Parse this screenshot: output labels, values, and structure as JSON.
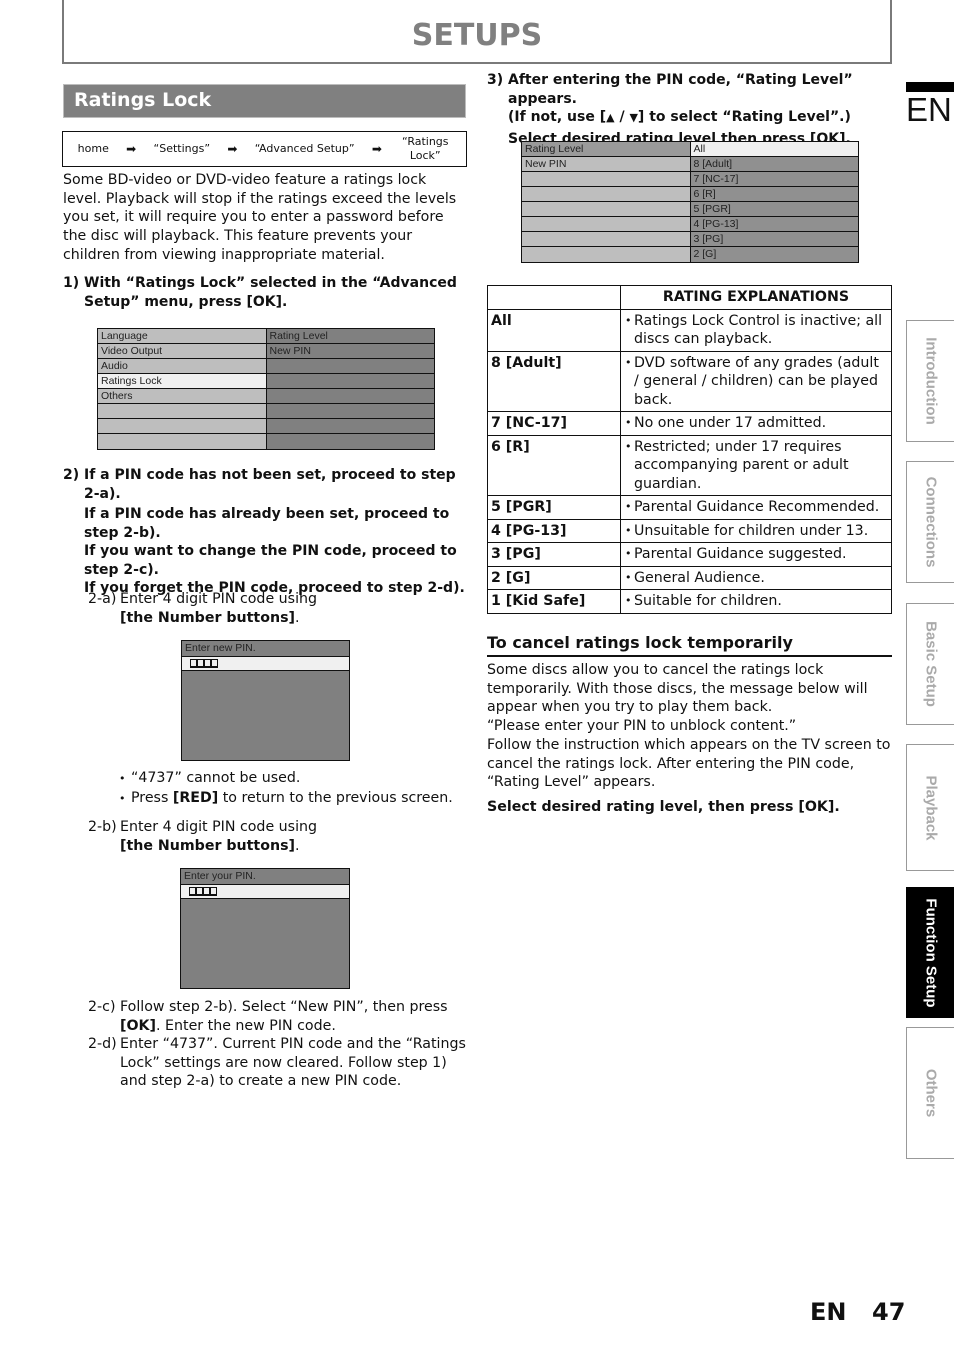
{
  "header": {
    "title": "SETUPS"
  },
  "section": {
    "title": "Ratings Lock"
  },
  "breadcrumb": {
    "items": [
      "home",
      "“Settings”",
      "“Advanced Setup”",
      "“Ratings Lock”"
    ],
    "separator_icon": "arrow-right-icon"
  },
  "intro": "Some BD-video or DVD-video feature a ratings lock level. Playback will stop if the ratings exceed the levels you set, it will require you to enter a password before the disc will playback. This feature prevents your children from viewing inappropriate material.",
  "step1": {
    "num": "1)",
    "text": "With “Ratings Lock” selected in the “Advanced Setup” menu, press [OK]."
  },
  "menu1": {
    "left": [
      "Language",
      "Video Output",
      "Audio",
      "Ratings Lock",
      "Others",
      "",
      "",
      ""
    ],
    "right": [
      "Rating Level",
      "New PIN",
      "",
      "",
      "",
      "",
      "",
      ""
    ],
    "selected_left": "Ratings Lock"
  },
  "step2": {
    "num": "2)",
    "lines": [
      "If a PIN code has not been set, proceed to step 2-a).",
      "If a PIN code has already been set, proceed to step 2-b).",
      "If you want to change the PIN code, proceed to step 2-c).",
      "If you forget the PIN code, proceed to step 2-d)."
    ]
  },
  "step2a": {
    "label": "2-a)",
    "text": "Enter 4 digit PIN code using",
    "button": "[the Number buttons]",
    "suffix": "."
  },
  "pin_new": {
    "header": "Enter new PIN.",
    "digits": 4
  },
  "notes": [
    {
      "pre": "“4737” cannot be used.",
      "bold": "",
      "post": ""
    },
    {
      "pre": "Press ",
      "bold": "[RED]",
      "post": " to return to the previous screen."
    }
  ],
  "step2b": {
    "label": "2-b)",
    "text": "Enter 4 digit PIN code using",
    "button": "[the Number buttons]",
    "suffix": "."
  },
  "pin_your": {
    "header": "Enter your PIN.",
    "digits": 4
  },
  "step2c": {
    "label": "2-c)",
    "pre": "Follow step 2-b). Select “New PIN”, then press ",
    "bold": "[OK]",
    "post": ". Enter the new PIN code."
  },
  "step2d": {
    "label": "2-d)",
    "text": "Enter “4737”. Current PIN code and the “Ratings Lock” settings are now cleared. Follow step 1) and step 2-a) to create a new PIN code."
  },
  "step3": {
    "num": "3)",
    "line1": "After entering the PIN code, “Rating Level” appears.",
    "line2_pre": "(If not, use [",
    "up_icon": "▲",
    "slash": " / ",
    "down_icon": "▼",
    "line2_post": "] to select “Rating Level”.)",
    "line3": "Select desired rating level then press [OK]."
  },
  "menu2": {
    "left": [
      "Rating Level",
      "New PIN",
      "",
      "",
      "",
      "",
      "",
      ""
    ],
    "right": [
      "All",
      "8 [Adult]",
      "7 [NC-17]",
      "6 [R]",
      "5 [PGR]",
      "4 [PG-13]",
      "3 [PG]",
      "2 [G]"
    ],
    "selected_right": "All"
  },
  "rating_table": {
    "header": [
      "",
      "RATING EXPLANATIONS"
    ],
    "rows": [
      {
        "level": "All",
        "desc": "Ratings Lock Control is inactive; all discs can playback."
      },
      {
        "level": "8 [Adult]",
        "desc": "DVD software of any grades (adult / general / children) can be played back."
      },
      {
        "level": "7 [NC-17]",
        "desc": "No one under 17 admitted."
      },
      {
        "level": "6 [R]",
        "desc": "Restricted; under 17 requires accompanying parent or adult guardian."
      },
      {
        "level": "5 [PGR]",
        "desc": "Parental Guidance Recommended."
      },
      {
        "level": "4 [PG-13]",
        "desc": "Unsuitable for children under 13."
      },
      {
        "level": "3 [PG]",
        "desc": "Parental Guidance suggested."
      },
      {
        "level": "2 [G]",
        "desc": "General Audience."
      },
      {
        "level": "1 [Kid Safe]",
        "desc": "Suitable for children."
      }
    ]
  },
  "cancel": {
    "title": "To cancel ratings lock temporarily",
    "body1": "Some discs allow you to cancel the ratings lock temporarily. With those discs, the message below will appear when you try to play them back.",
    "body2": "“Please enter your PIN to unblock content.”",
    "body3": "Follow the instruction which appears on the TV screen to cancel the ratings lock. After entering the PIN code, “Rating Level” appears.",
    "action": "Select desired rating level, then press [OK]."
  },
  "side": {
    "lang": "EN",
    "tabs": [
      {
        "label": "Introduction",
        "active": false
      },
      {
        "label": "Connections",
        "active": false
      },
      {
        "label": "Basic Setup",
        "active": false
      },
      {
        "label": "Playback",
        "active": false
      },
      {
        "label": "Function Setup",
        "active": true
      },
      {
        "label": "Others",
        "active": false
      }
    ]
  },
  "footer": {
    "lang": "EN",
    "page": "47"
  }
}
